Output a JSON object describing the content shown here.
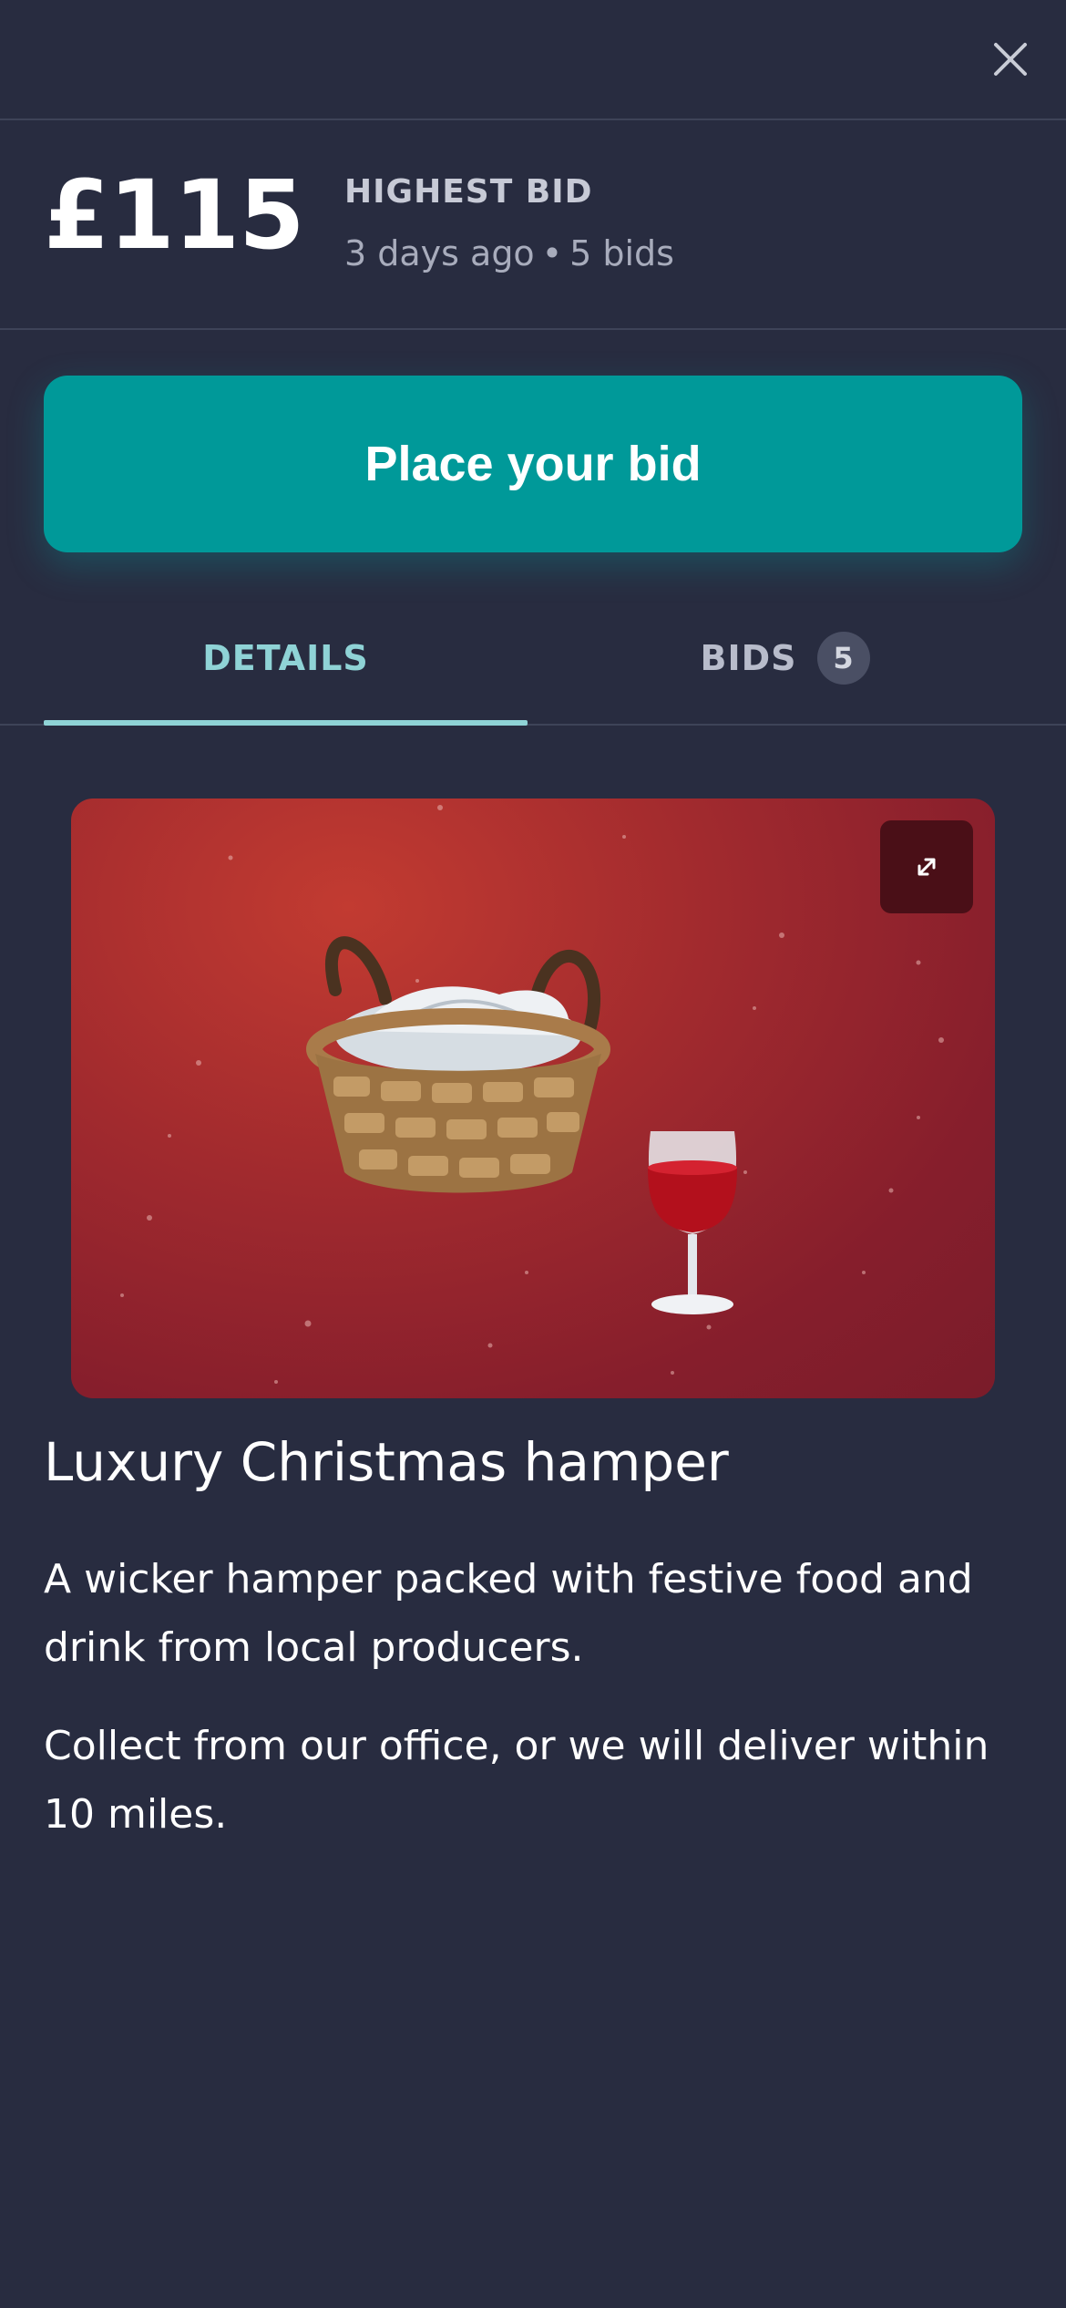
{
  "header": {
    "close_icon": "close-icon"
  },
  "bid_summary": {
    "amount": "£115",
    "label": "HIGHEST BID",
    "time_ago": "3 days ago",
    "separator": "•",
    "bid_count_text": "5 bids"
  },
  "actions": {
    "place_bid_label": "Place your bid"
  },
  "tabs": [
    {
      "label": "DETAILS",
      "active": true
    },
    {
      "label": "BIDS",
      "badge": "5",
      "active": false
    }
  ],
  "item": {
    "image_icons": [
      "basket-icon",
      "wine-glass-icon"
    ],
    "expand_icon": "expand-icon",
    "title": "Luxury Christmas hamper",
    "description": [
      "A wicker hamper packed with festive food and drink from local producers.",
      "Collect from our office, or we will deliver within 10 miles."
    ]
  },
  "colors": {
    "background": "#282c40",
    "accent": "#009999",
    "active_tab": "#8fd3d6",
    "image_background": "#a12a2e"
  }
}
